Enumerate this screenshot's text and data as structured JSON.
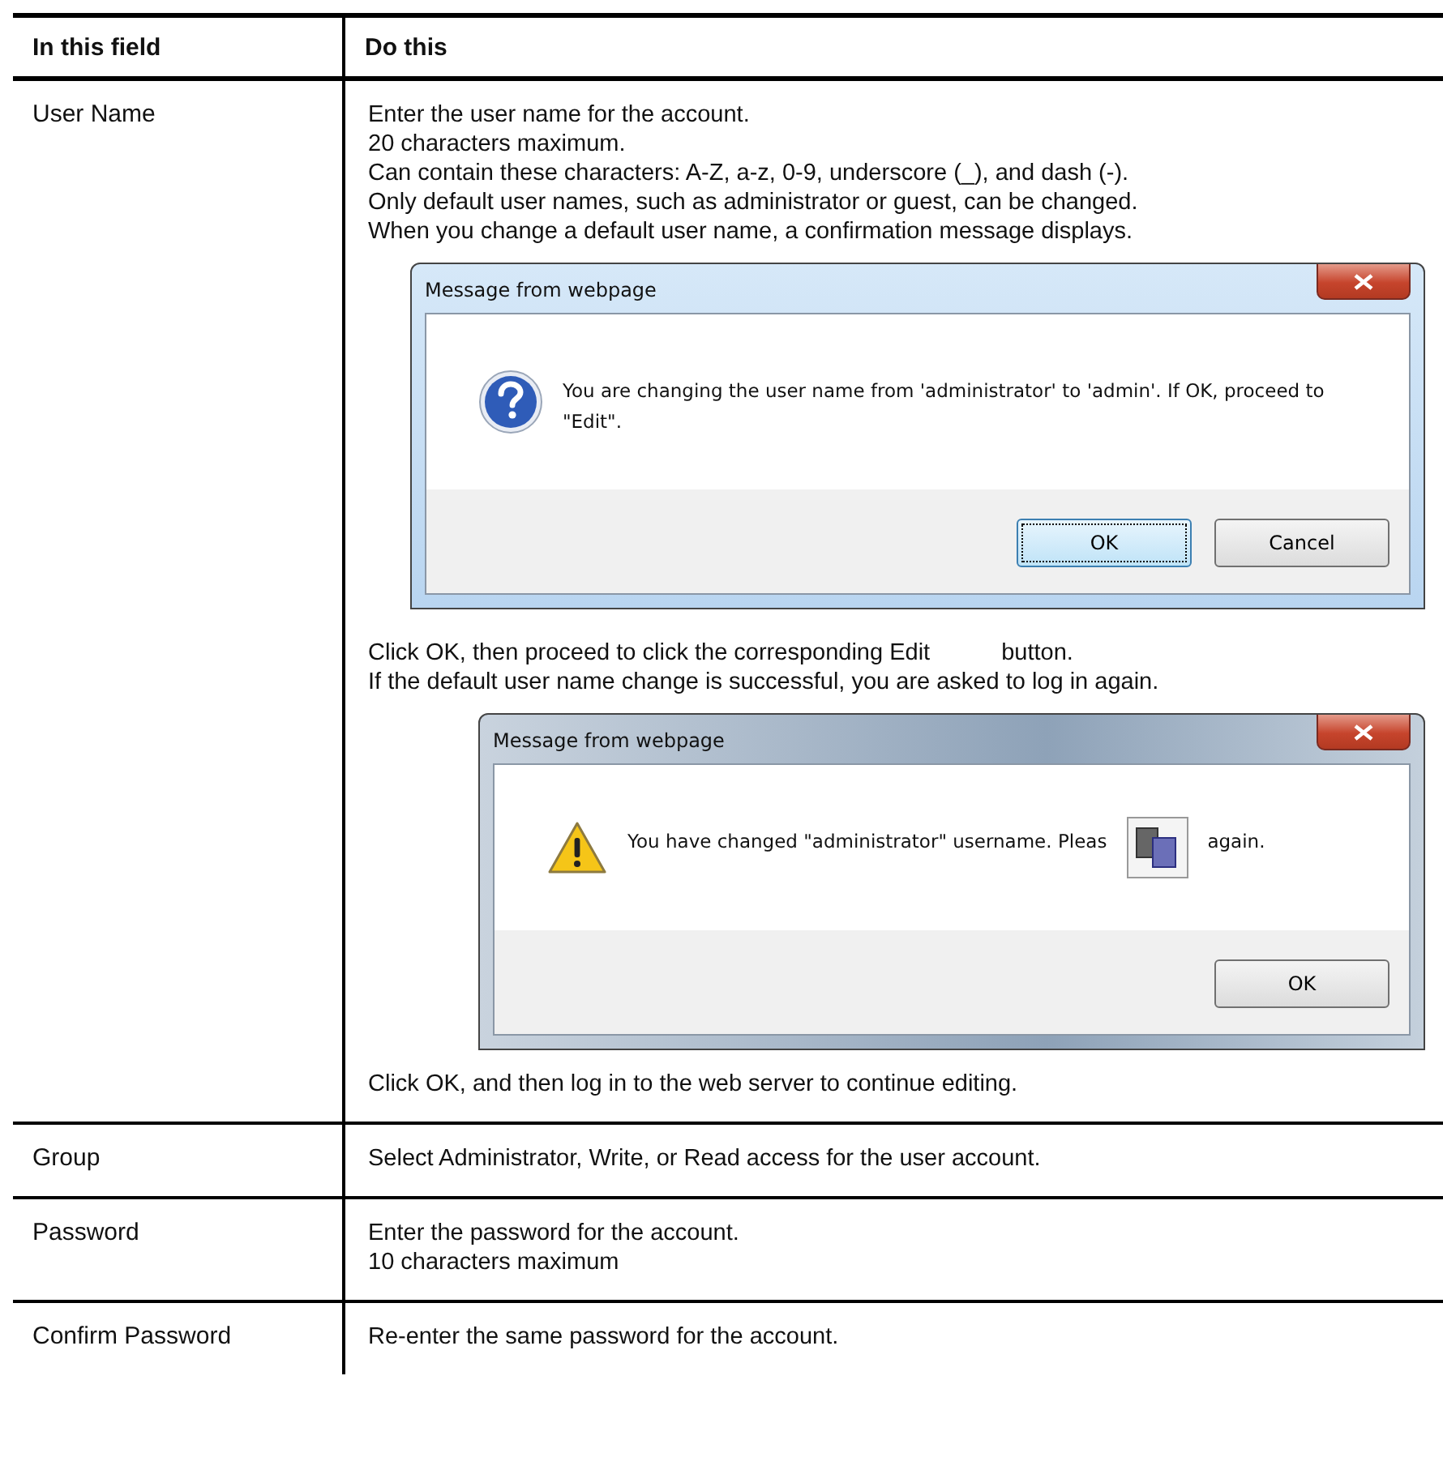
{
  "table": {
    "columns": [
      "In this field",
      "Do this"
    ],
    "rows": [
      {
        "field": "User Name",
        "content": [
          {
            "kind": "text",
            "lines": [
              "Enter the user name for the account.",
              "20 characters maximum.",
              "Can contain these characters: A-Z, a-z, 0-9, underscore (_), and dash (-).",
              "Only default user names, such as administrator or guest, can be changed.",
              "When you change a default user name, a confirmation message displays."
            ]
          },
          {
            "kind": "question_dialog",
            "title": "Message from webpage",
            "message": "You are changing the user name from 'administrator' to 'admin'. If OK, proceed to \"Edit\".",
            "buttons": [
              {
                "label": "OK",
                "selected": true
              },
              {
                "label": "Cancel",
                "selected": false
              }
            ]
          },
          {
            "kind": "text_gap",
            "before": "Click OK, then proceed to click the corresponding Edit",
            "after": "button."
          },
          {
            "kind": "text",
            "lines": [
              "If the default user name change is successful, you are asked to log in again."
            ]
          },
          {
            "kind": "warning_dialog",
            "title": "Message from webpage",
            "message": "You have changed \"administrator\" username. Pleas",
            "message_after": "again.",
            "buttons": [
              {
                "label": "OK",
                "selected": false
              }
            ]
          },
          {
            "kind": "text",
            "lines": [
              "Click OK, and then log in to the web server to continue editing."
            ]
          }
        ]
      },
      {
        "field": "Group",
        "content": [
          {
            "kind": "text",
            "lines": [
              "Select Administrator, Write, or Read access for the user account."
            ]
          }
        ]
      },
      {
        "field": "Password",
        "content": [
          {
            "kind": "text",
            "lines": [
              "Enter the password for the account.",
              "10 characters maximum"
            ]
          }
        ]
      },
      {
        "field": "Confirm Password",
        "content": [
          {
            "kind": "text",
            "lines": [
              "Re-enter the same password for the account."
            ]
          }
        ]
      }
    ]
  }
}
